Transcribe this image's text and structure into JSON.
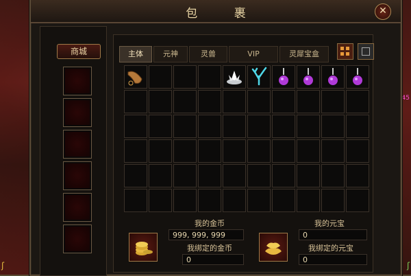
{
  "window": {
    "title": "包 裹"
  },
  "side": {
    "right_text": "45"
  },
  "shop": {
    "label": "商城",
    "slots": 6
  },
  "tabs": [
    {
      "label": "主体",
      "active": true
    },
    {
      "label": "元神",
      "active": false
    },
    {
      "label": "灵兽",
      "active": false
    },
    {
      "label": "VIP",
      "active": false
    },
    {
      "label": "灵犀宝盒",
      "active": false
    }
  ],
  "toolbar_icons": [
    "grid-view-icon",
    "list-view-icon"
  ],
  "bag": {
    "rows": 6,
    "cols": 10,
    "items": [
      {
        "index": 0,
        "name": "horn-item-icon"
      },
      {
        "index": 4,
        "name": "lotus-item-icon"
      },
      {
        "index": 5,
        "name": "coral-item-icon"
      },
      {
        "index": 6,
        "name": "purple-potion-icon"
      },
      {
        "index": 7,
        "name": "purple-potion-icon"
      },
      {
        "index": 8,
        "name": "purple-potion-icon"
      },
      {
        "index": 9,
        "name": "purple-potion-icon"
      }
    ]
  },
  "currency": {
    "gold_label": "我的金币",
    "gold_value": "999, 999, 999",
    "bound_gold_label": "我绑定的金币",
    "bound_gold_value": "0",
    "yuanbao_label": "我的元宝",
    "yuanbao_value": "0",
    "bound_yuanbao_label": "我绑定的元宝",
    "bound_yuanbao_value": "0"
  },
  "colors": {
    "gold_text": "#e7d3a3",
    "potion": "#b03ad8",
    "coral": "#4fd8e8"
  }
}
